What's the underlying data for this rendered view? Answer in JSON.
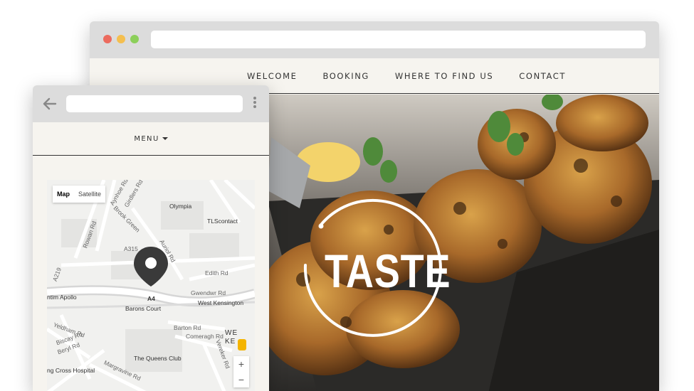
{
  "desktop": {
    "nav": [
      "WELCOME",
      "BOOKING",
      "WHERE TO FIND US",
      "CONTACT"
    ],
    "logo_text": "TASTE",
    "colors": {
      "close": "#ec6b5e",
      "minimize": "#f4bf4f",
      "maximize": "#8ccf5a"
    }
  },
  "mobile": {
    "menu_label": "MENU",
    "map": {
      "type_options": [
        "Map",
        "Satellite"
      ],
      "selected_type": "Map",
      "labels": {
        "olympia": "Olympia",
        "tlscontact": "TLScontact",
        "a315": "A315",
        "edith_rd": "Edith Rd",
        "gwendwr_rd": "Gwendwr Rd",
        "a4": "A4",
        "barons_court": "Barons Court",
        "west_kensington": "West Kensington",
        "apollo": "ntim Apollo",
        "a219": "A219",
        "barton_rd": "Barton Rd",
        "comeragh_rd": "Comeragh Rd",
        "queens_club": "The Queens Club",
        "cross_hospital": "ng Cross Hospital",
        "margravine_rd": "Margravine Rd",
        "rowan_rd": "Rowan Rd",
        "brook_green": "Brook Green",
        "aynhoe_rd": "Aynhoe Rd",
        "girdlers_rd": "Girdlers Rd",
        "auriol_rd": "Auriol Rd",
        "yeldham_rd": "Yeldham Rd",
        "biscay_rd": "Biscay Rd",
        "beryl_rd": "Beryl Rd",
        "vereker_rd": "Vereker Rd",
        "we_ke": "WE\nKE"
      },
      "zoom_in": "+",
      "zoom_out": "−"
    }
  },
  "icons": {
    "back": "arrow-left-icon",
    "kebab": "more-vert-icon",
    "pin": "map-pin-icon",
    "pegman": "street-view-icon"
  }
}
